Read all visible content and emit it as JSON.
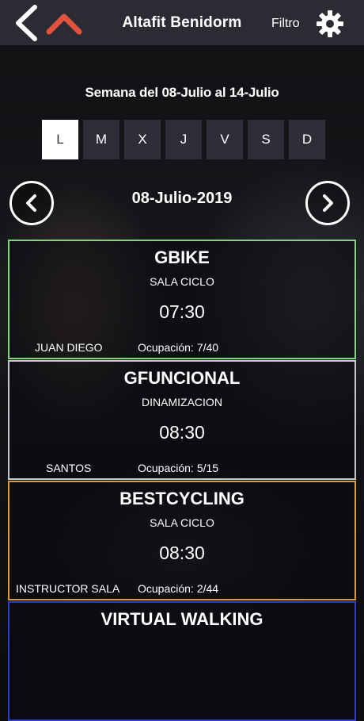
{
  "header": {
    "title": "Altafit Benidorm",
    "filter_label": "Filtro",
    "back_icon": "chevron-left-icon",
    "up_icon": "chevron-up-icon",
    "settings_icon": "gear-icon",
    "accent_color": "#e0533e",
    "bar_color": "#2b2b34"
  },
  "schedule": {
    "week_label": "Semana del 08-Julio al 14-Julio",
    "days": [
      "L",
      "M",
      "X",
      "J",
      "V",
      "S",
      "D"
    ],
    "selected_day": "L",
    "current_date": "08-Julio-2019",
    "prev_icon": "chevron-left-circle-icon",
    "next_icon": "chevron-right-circle-icon"
  },
  "occupancy_label": "Ocupación:",
  "classes": [
    {
      "name": "GBIKE",
      "room": "SALA CICLO",
      "time": "07:30",
      "instructor": "JUAN DIEGO",
      "occupancy": "7/40",
      "border_color": "#7ed67a"
    },
    {
      "name": "GFUNCIONAL",
      "room": "DINAMIZACION",
      "time": "08:30",
      "instructor": "SANTOS",
      "occupancy": "5/15",
      "border_color": "#c8c8cc"
    },
    {
      "name": "BESTCYCLING",
      "room": "SALA CICLO",
      "time": "08:30",
      "instructor": "INSTRUCTOR SALA",
      "occupancy": "2/44",
      "border_color": "#e09a36"
    },
    {
      "name": "VIRTUAL WALKING",
      "room": "",
      "time": "",
      "instructor": "",
      "occupancy": "",
      "border_color": "#2a3cc8"
    }
  ]
}
